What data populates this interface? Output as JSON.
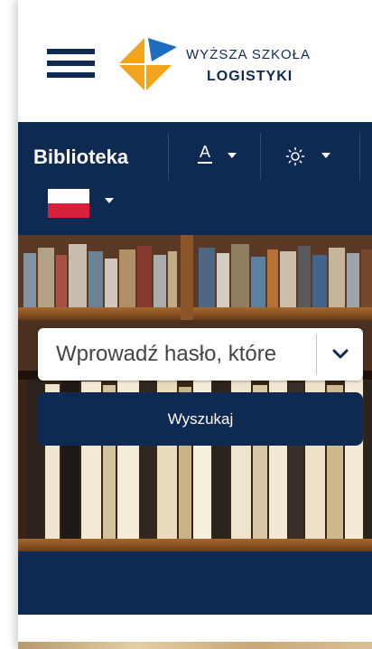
{
  "header": {
    "menu_icon": "hamburger-menu-icon",
    "logo": {
      "line1": "WYŻSZA SZKOŁA",
      "line2": "LOGISTYKI",
      "colors": {
        "orange": "#f2a41c",
        "blue": "#1f6dbf",
        "navy": "#0f2a52"
      }
    }
  },
  "navbar": {
    "title": "Biblioteka",
    "font_size_icon": "font-size-icon",
    "font_size_glyph": "A",
    "contrast_icon": "sun-icon",
    "language": {
      "flag": "poland-flag-icon",
      "caret": "caret-down-icon"
    }
  },
  "search": {
    "placeholder": "Wprowadź hasło, które",
    "dropdown_icon": "chevron-down-icon",
    "button_label": "Wyszukaj"
  },
  "colors": {
    "primary": "#0f2a52",
    "white": "#ffffff",
    "flag_red": "#d8203a"
  }
}
